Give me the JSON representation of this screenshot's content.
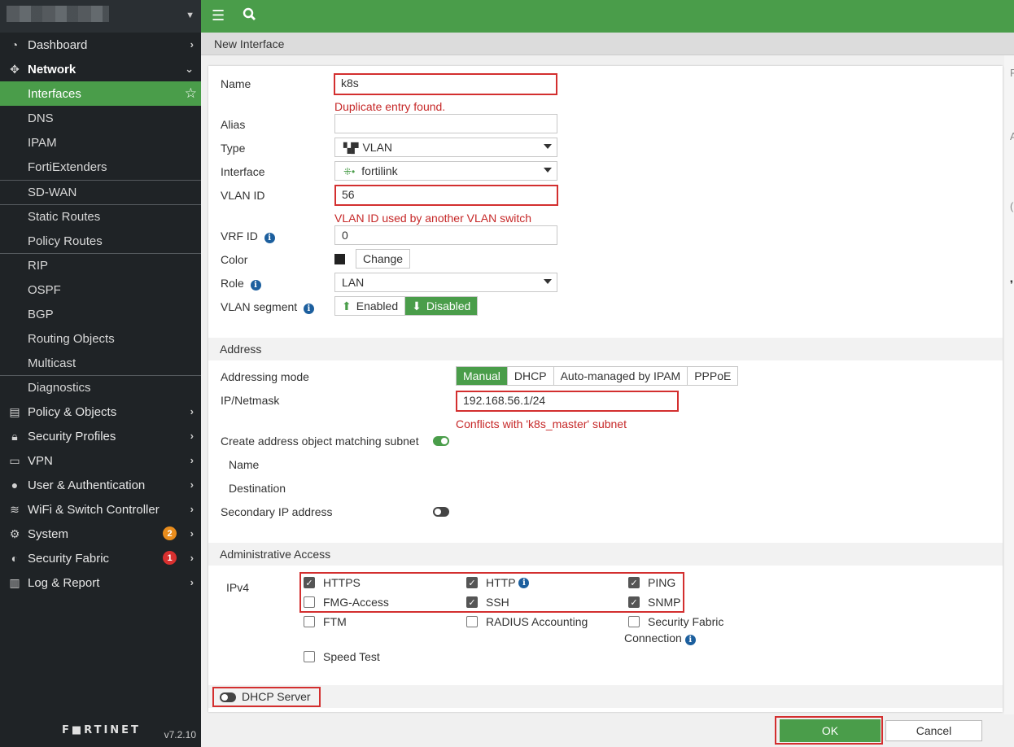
{
  "sidebar": {
    "nav": [
      {
        "label": "Dashboard",
        "icon": "dashboard-icon"
      },
      {
        "label": "Network",
        "icon": "network-move-icon"
      }
    ],
    "network_sub": [
      "Interfaces",
      "DNS",
      "IPAM",
      "FortiExtenders",
      "SD-WAN",
      "Static Routes",
      "Policy Routes",
      "RIP",
      "OSPF",
      "BGP",
      "Routing Objects",
      "Multicast",
      "Diagnostics"
    ],
    "nav_bottom": [
      {
        "label": "Policy & Objects",
        "icon": "policy-icon"
      },
      {
        "label": "Security Profiles",
        "icon": "lock-icon"
      },
      {
        "label": "VPN",
        "icon": "laptop-icon"
      },
      {
        "label": "User & Authentication",
        "icon": "user-icon"
      },
      {
        "label": "WiFi & Switch Controller",
        "icon": "wifi-icon"
      },
      {
        "label": "System",
        "icon": "gear-icon",
        "badge": "2"
      },
      {
        "label": "Security Fabric",
        "icon": "fabric-icon",
        "badge": "1"
      },
      {
        "label": "Log & Report",
        "icon": "chart-icon"
      }
    ],
    "logo": "F■RTINET",
    "version": "v7.2.10"
  },
  "page_title": "New Interface",
  "form": {
    "name_label": "Name",
    "name_value": "k8s",
    "name_error": "Duplicate entry found.",
    "alias_label": "Alias",
    "alias_value": "",
    "type_label": "Type",
    "type_value": "VLAN",
    "interface_label": "Interface",
    "interface_value": "fortilink",
    "vlan_label": "VLAN ID",
    "vlan_value": "56",
    "vlan_error": "VLAN ID used by another VLAN switch",
    "vrf_label": "VRF ID",
    "vrf_value": "0",
    "color_label": "Color",
    "color_button": "Change",
    "role_label": "Role",
    "role_value": "LAN",
    "segment_label": "VLAN segment",
    "segment_enabled": "Enabled",
    "segment_disabled": "Disabled"
  },
  "address": {
    "section": "Address",
    "mode_label": "Addressing mode",
    "modes": [
      "Manual",
      "DHCP",
      "Auto-managed by IPAM",
      "PPPoE"
    ],
    "ip_label": "IP/Netmask",
    "ip_value": "192.168.56.1/24",
    "ip_error": "Conflicts with 'k8s_master' subnet",
    "create_label": "Create address object matching subnet",
    "name_label": "Name",
    "dest_label": "Destination",
    "secondary_label": "Secondary IP address"
  },
  "admin": {
    "section": "Administrative Access",
    "ipv4_label": "IPv4",
    "items": {
      "https": "HTTPS",
      "http": "HTTP",
      "ping": "PING",
      "fmg": "FMG-Access",
      "ssh": "SSH",
      "snmp": "SNMP",
      "ftm": "FTM",
      "radius": "RADIUS Accounting",
      "fabric1": "Security Fabric",
      "fabric2": "Connection",
      "speed": "Speed Test"
    }
  },
  "dhcp_label": "DHCP Server",
  "buttons": {
    "ok": "OK",
    "cancel": "Cancel"
  },
  "colors": {
    "accent": "#4a9d4a",
    "error": "#d32f2f",
    "sidebar": "#1f2326"
  }
}
